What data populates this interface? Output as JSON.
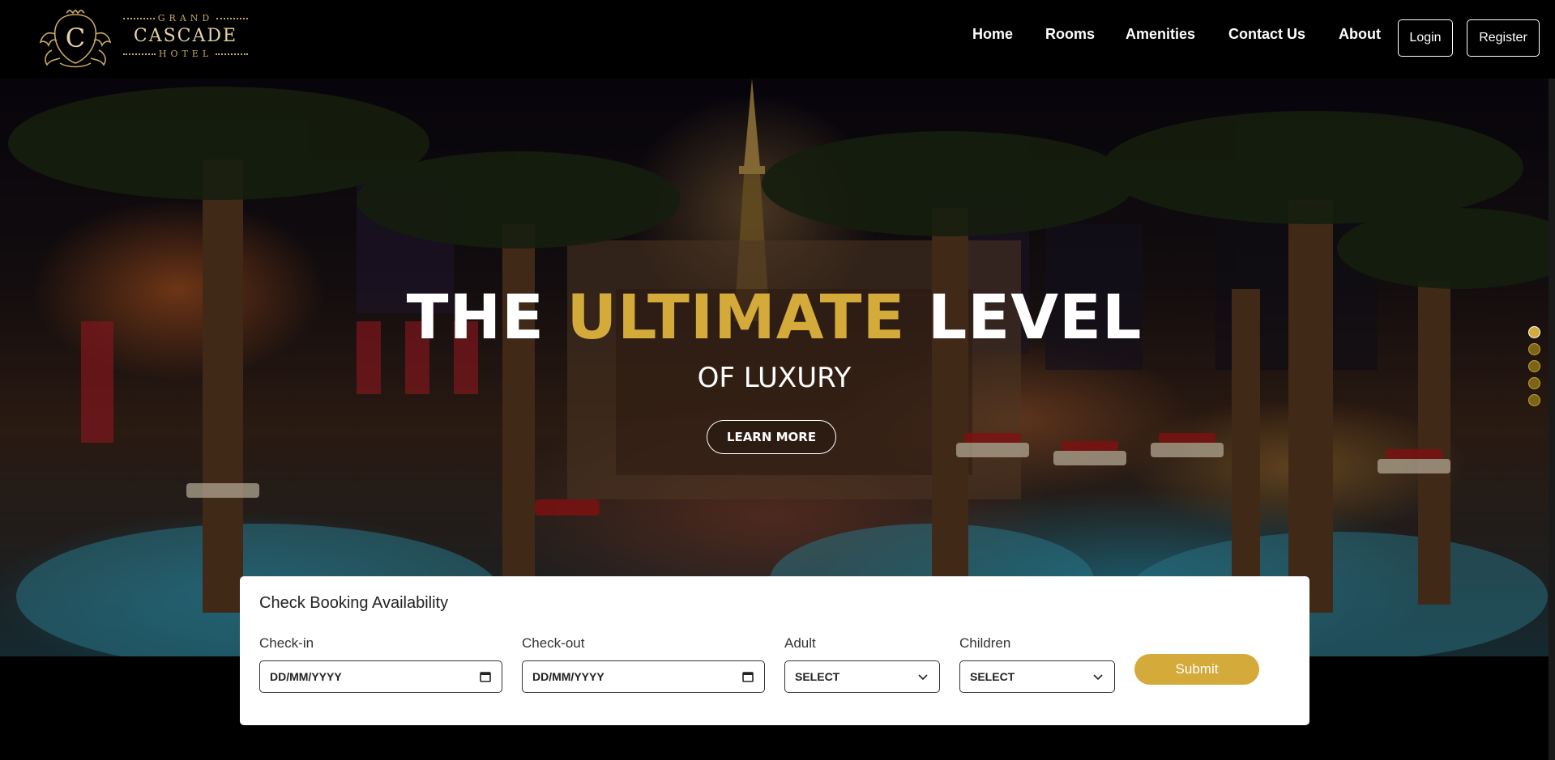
{
  "brand": {
    "top_word": "GRAND",
    "name": "CASCADE",
    "bottom_word": "HOTEL",
    "crest_letter": "C",
    "colors": {
      "gold": "#c9a961",
      "accent": "#d4aa3a"
    }
  },
  "nav": {
    "links": [
      "Home",
      "Rooms",
      "Amenities",
      "Contact Us",
      "About"
    ],
    "login_label": "Login",
    "register_label": "Register"
  },
  "hero": {
    "title_part1": "THE ",
    "title_accent": "ULTIMATE",
    "title_part2": " LEVEL",
    "subtitle": "OF LUXURY",
    "cta_label": "LEARN MORE",
    "slides_count": 5,
    "active_slide": 1
  },
  "booking": {
    "title": "Check Booking Availability",
    "checkin_label": "Check-in",
    "checkin_value": "DD/MM/YYYY",
    "checkout_label": "Check-out",
    "checkout_value": "DD/MM/YYYY",
    "adult_label": "Adult",
    "adult_value": "SELECT",
    "children_label": "Children",
    "children_value": "SELECT",
    "submit_label": "Submit",
    "icons": {
      "date": "calendar-icon",
      "select": "chevron-down-icon"
    }
  }
}
